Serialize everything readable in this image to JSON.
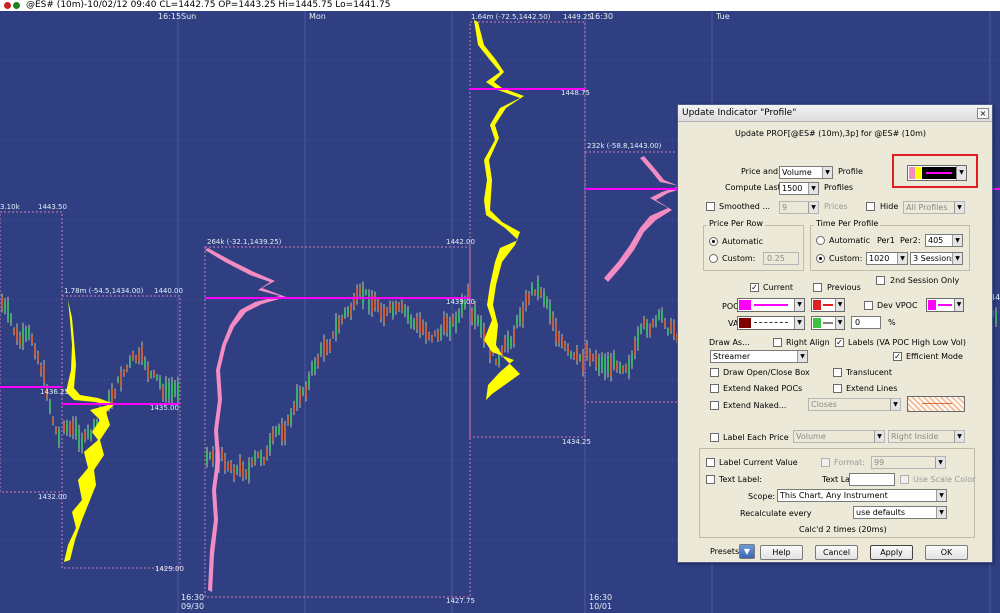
{
  "header": {
    "symbol_info": "@ES# (10m)-10/02/12 09:40 CL=1442.75 OP=1443.25 Hi=1445.75 Lo=1441.75",
    "dot_colors": [
      "#cc2020",
      "#208020"
    ]
  },
  "chart": {
    "background": "#2f3f82",
    "time_labels": [
      "16:15",
      "Sun",
      "Mon",
      "16:30",
      "Tue",
      "16:30",
      "09/30",
      "16:30",
      "10/01"
    ],
    "profiles": [
      {
        "label": "3.10k",
        "hi": "1443.50",
        "lo": "1432.00"
      },
      {
        "label": "1.78m (-54.5,1434.00)",
        "hi": "1440.00",
        "lo": "1429.00",
        "poc": "1436.25",
        "va": "1435.00"
      },
      {
        "label": "264k (-32.1,1439.25)",
        "lo": "1427.75",
        "va": "1442.00",
        "poc": "1439.00"
      },
      {
        "label": "1.64m (-72.5,1442.50)",
        "hi": "1449.25",
        "poc": "1448.75",
        "lo": "1434.25"
      },
      {
        "label": "232k (-58.8,1443.00)"
      }
    ],
    "right_axis": "44"
  },
  "dialog": {
    "title": "Update Indicator \"Profile\"",
    "close_label": "×",
    "subtitle": "Update PROF[@ES# (10m),3p] for @ES# (10m)",
    "price_and_label": "Price and",
    "price_and_value": "Volume",
    "profile_label": "Profile",
    "compute_last_label": "Compute Last",
    "compute_last_value": "1500",
    "profiles_label": "Profiles",
    "smoothed_label": "Smoothed ...",
    "smoothed_value": "9",
    "prices_label": "Prices",
    "hide_label": "Hide",
    "hide_value": "All Profiles",
    "price_per_row": {
      "title": "Price Per Row",
      "automatic_label": "Automatic",
      "custom_label": "Custom:",
      "custom_value": "0.25"
    },
    "time_per_profile": {
      "title": "Time Per Profile",
      "automatic_label": "Automatic",
      "per1_label": "Per1",
      "per2_label": "Per2:",
      "per2_value": "405",
      "custom_label": "Custom:",
      "custom_value": "1020",
      "sessions_value": "3 Sessions"
    },
    "second_session_label": "2nd Session Only",
    "current_label": "Current",
    "previous_label": "Previous",
    "poc_label": "POC:",
    "va_label": "VA:",
    "dev_vpoc_label": "Dev VPOC",
    "va_pct_value": "0",
    "pct_label": "%",
    "draw_as_label": "Draw As...",
    "right_align_label": "Right Align",
    "labels_label": "Labels (VA POC High Low Vol)",
    "draw_as_value": "Streamer",
    "efficient_mode_label": "Efficient Mode",
    "draw_open_close_label": "Draw Open/Close Box",
    "translucent_label": "Translucent",
    "extend_naked_pocs_label": "Extend Naked POCs",
    "extend_lines_label": "Extend Lines",
    "extend_naked_label": "Extend Naked...",
    "extend_naked_value": "Closes",
    "label_each_price_label": "Label Each Price",
    "label_each_price_value": "Volume",
    "label_each_price_pos": "Right Inside",
    "label_current_value_label": "Label Current Value",
    "format_label": "Format:",
    "format_value": "99",
    "text_label_label": "Text Label:",
    "text_label_field_label": "Text Label:",
    "use_scale_color_label": "Use Scale Color",
    "scope_label": "Scope:",
    "scope_value": "This Chart, Any Instrument",
    "recalculate_label": "Recalculate every",
    "recalculate_value": "use defaults",
    "calc_status": "Calc'd 2 times (20ms)",
    "presets_label": "Presets",
    "help_label": "Help",
    "cancel_label": "Cancel",
    "apply_label": "Apply",
    "ok_label": "OK",
    "colors": {
      "poc": "#ff00ff",
      "va": "#800000",
      "profile_yellow": "#ffff00",
      "highlight_red": "#e02020",
      "va_green": "#40c040"
    }
  }
}
